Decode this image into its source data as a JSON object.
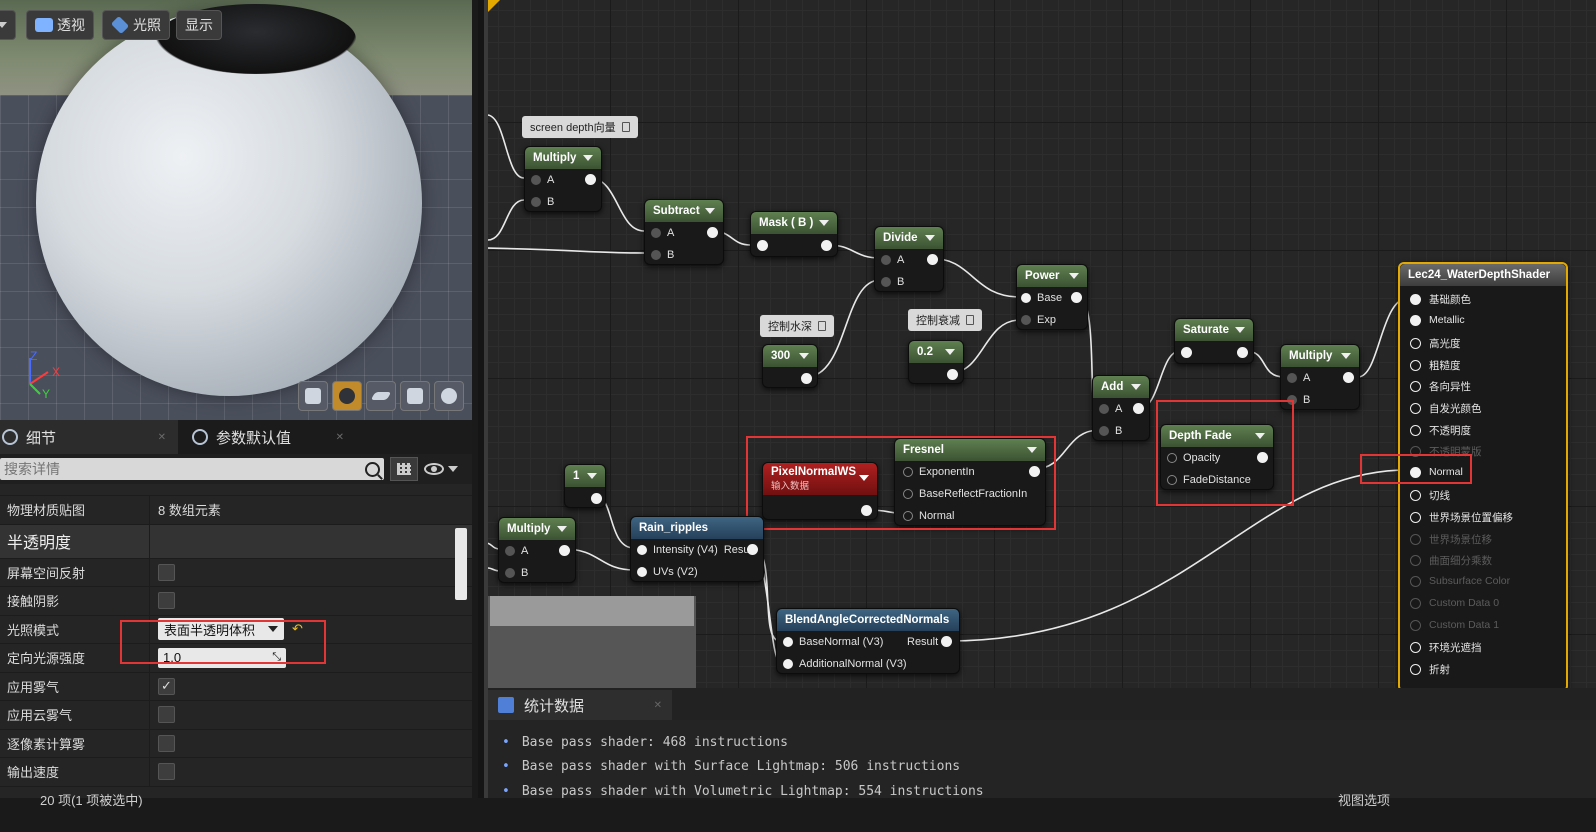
{
  "viewport": {
    "buttons": [
      {
        "label": "透视",
        "icon": "perspective-icon"
      },
      {
        "label": "光照",
        "icon": "lit-cube-icon"
      },
      {
        "label": "显示",
        "icon": ""
      }
    ],
    "axis": {
      "z": "Z",
      "x": "X",
      "y": "Y"
    },
    "preview_shapes": [
      "cylinder-icon",
      "sphere-icon",
      "plane-icon",
      "cube-icon",
      "teapot-icon"
    ]
  },
  "details": {
    "tabs": [
      {
        "label": "细节",
        "icon": "details-icon"
      },
      {
        "label": "参数默认值",
        "icon": "parameters-icon"
      }
    ],
    "search_placeholder": "搜索详情",
    "rows": [
      {
        "label": "物理材质贴图",
        "value": "8 数组元素",
        "kind": "text"
      },
      {
        "label": "半透明度",
        "kind": "section"
      },
      {
        "label": "屏幕空间反射",
        "kind": "checkbox",
        "checked": false
      },
      {
        "label": "接触阴影",
        "kind": "checkbox",
        "checked": false
      },
      {
        "label": "光照模式",
        "kind": "dropdown",
        "value": "表面半透明体积"
      },
      {
        "label": "定向光源强度",
        "kind": "number",
        "value": "1.0"
      },
      {
        "label": "应用雾气",
        "kind": "checkbox",
        "checked": true
      },
      {
        "label": "应用云雾气",
        "kind": "checkbox",
        "checked": false
      },
      {
        "label": "逐像素计算雾",
        "kind": "checkbox",
        "checked": false
      },
      {
        "label": "输出速度",
        "kind": "checkbox",
        "checked": false
      }
    ]
  },
  "graph": {
    "comments": {
      "screen_depth": "screen depth向量",
      "water_depth": "控制水深",
      "falloff": "控制衰减"
    },
    "nodes": {
      "multiply1": {
        "title": "Multiply",
        "a": "A",
        "b": "B"
      },
      "subtract": {
        "title": "Subtract",
        "a": "A",
        "b": "B"
      },
      "mask": {
        "title": "Mask ( B )"
      },
      "divide": {
        "title": "Divide",
        "a": "A",
        "b": "B"
      },
      "power": {
        "title": "Power",
        "base": "Base",
        "exp": "Exp"
      },
      "const300": {
        "title": "300"
      },
      "const02": {
        "title": "0.2"
      },
      "saturate": {
        "title": "Saturate"
      },
      "add": {
        "title": "Add",
        "a": "A",
        "b": "B"
      },
      "multiply2": {
        "title": "Multiply",
        "a": "A",
        "b": "B"
      },
      "depth_fade": {
        "title": "Depth Fade",
        "opacity": "Opacity",
        "fade_distance": "FadeDistance"
      },
      "fresnel": {
        "title": "Fresnel",
        "exponent": "ExponentIn",
        "base_reflect": "BaseReflectFractionIn",
        "normal": "Normal"
      },
      "pixel_normal": {
        "title": "PixelNormalWS",
        "subtitle": "输入数据"
      },
      "const1": {
        "title": "1"
      },
      "multiply3": {
        "title": "Multiply",
        "a": "A",
        "b": "B"
      },
      "rain": {
        "title": "Rain_ripples",
        "intensity": "Intensity (V4)",
        "result": "Result",
        "uvs": "UVs (V2)"
      },
      "blend": {
        "title": "BlendAngleCorrectedNormals",
        "base": "BaseNormal (V3)",
        "result": "Result",
        "additional": "AdditionalNormal (V3)"
      }
    },
    "result_node": {
      "title": "Lec24_WaterDepthShader",
      "pins": [
        {
          "label": "基础颜色",
          "enabled": true
        },
        {
          "label": "Metallic",
          "enabled": true
        },
        {
          "label": "高光度",
          "enabled": true
        },
        {
          "label": "粗糙度",
          "enabled": true
        },
        {
          "label": "各向异性",
          "enabled": true
        },
        {
          "label": "自发光颜色",
          "enabled": true
        },
        {
          "label": "不透明度",
          "enabled": true
        },
        {
          "label": "不透明蒙版",
          "enabled": false
        },
        {
          "label": "Normal",
          "enabled": true
        },
        {
          "label": "切线",
          "enabled": true
        },
        {
          "label": "世界场景位置偏移",
          "enabled": true
        },
        {
          "label": "世界场景位移",
          "enabled": false
        },
        {
          "label": "曲面细分乘数",
          "enabled": false
        },
        {
          "label": "Subsurface Color",
          "enabled": false
        },
        {
          "label": "Custom Data 0",
          "enabled": false
        },
        {
          "label": "Custom Data 1",
          "enabled": false
        },
        {
          "label": "环境光遮挡",
          "enabled": true
        },
        {
          "label": "折射",
          "enabled": true
        }
      ]
    }
  },
  "stats": {
    "tab_label": "统计数据",
    "lines": [
      "Base pass shader: 468 instructions",
      "Base pass shader with Surface Lightmap: 506 instructions",
      "Base pass shader with Volumetric Lightmap: 554 instructions"
    ]
  },
  "statusbar": {
    "left": "20 项(1 项被选中)",
    "right": "视图选项"
  }
}
